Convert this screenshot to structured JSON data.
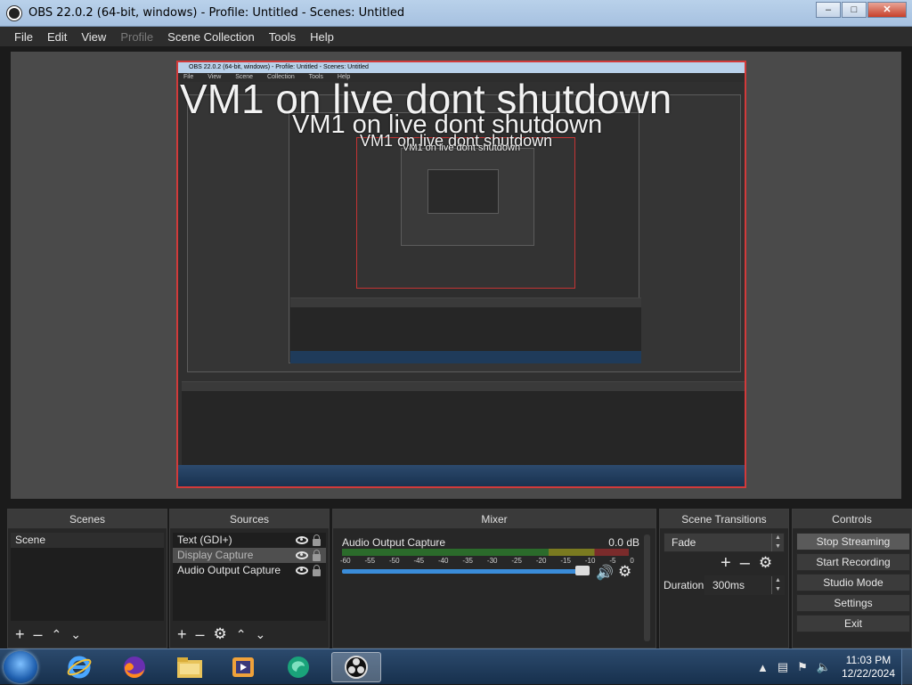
{
  "window": {
    "title": "OBS 22.0.2 (64-bit, windows) - Profile: Untitled - Scenes: Untitled",
    "minimize": "–",
    "maximize": "□",
    "close": "✕"
  },
  "menu": [
    "File",
    "Edit",
    "View",
    "Profile",
    "Scene Collection",
    "Tools",
    "Help"
  ],
  "preview": {
    "overlay_text": "VM1 on live dont shutdown",
    "nested_title": "OBS 22.0.2 (64-bit, windows) - Profile: Untitled - Scenes: Untitled",
    "nested_menu": "File View Scene Collection Tools Help"
  },
  "scenes": {
    "header": "Scenes",
    "items": [
      "Scene"
    ]
  },
  "sources": {
    "header": "Sources",
    "items": [
      "Text (GDI+)",
      "Display Capture",
      "Audio Output Capture"
    ]
  },
  "mixer": {
    "header": "Mixer",
    "channel": "Audio Output Capture",
    "level": "0.0 dB",
    "ticks": [
      "-60",
      "-55",
      "-50",
      "-45",
      "-40",
      "-35",
      "-30",
      "-25",
      "-20",
      "-15",
      "-10",
      "-5",
      "0"
    ],
    "volume_fraction": 0.96
  },
  "transitions": {
    "header": "Scene Transitions",
    "selected": "Fade",
    "duration_label": "Duration",
    "duration_value": "300ms"
  },
  "controls": {
    "header": "Controls",
    "buttons": [
      "Stop Streaming",
      "Start Recording",
      "Studio Mode",
      "Settings",
      "Exit"
    ]
  },
  "taskbar": {
    "time": "11:03 PM",
    "date": "12/22/2024",
    "apps": [
      "internet-explorer-icon",
      "firefox-icon",
      "file-explorer-icon",
      "media-player-icon",
      "browser-app-icon",
      "obs-icon"
    ]
  },
  "colors": {
    "accent": "#3a8cd9",
    "preview_border": "#d23a3a"
  }
}
